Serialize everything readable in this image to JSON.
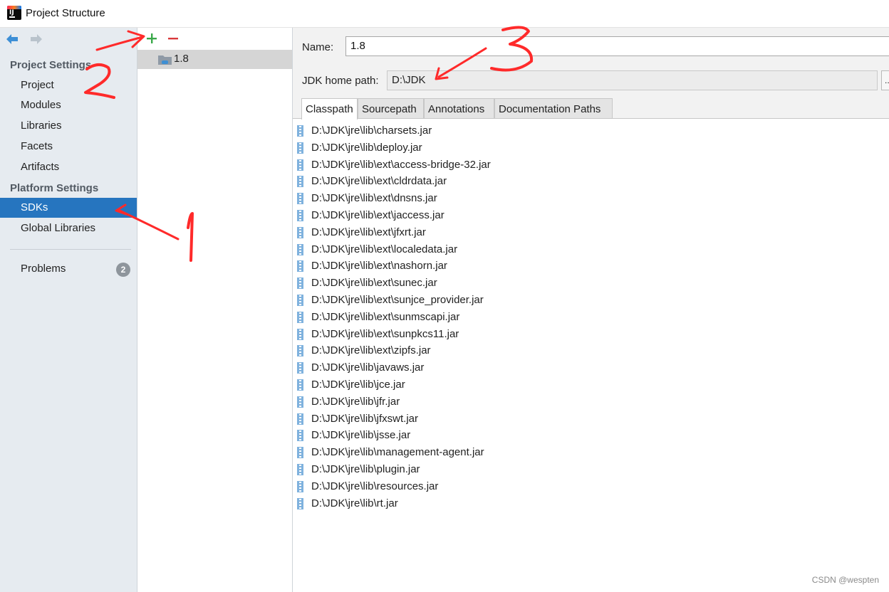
{
  "window": {
    "title": "Project Structure",
    "app_icon_text": "IJ"
  },
  "left_nav": {
    "project_settings_header": "Project Settings",
    "project_items": [
      "Project",
      "Modules",
      "Libraries",
      "Facets",
      "Artifacts"
    ],
    "platform_settings_header": "Platform Settings",
    "platform_items": [
      "SDKs",
      "Global Libraries"
    ],
    "selected": "SDKs",
    "problems": {
      "label": "Problems",
      "count": "2"
    }
  },
  "sdk_list": {
    "items": [
      "1.8"
    ],
    "selected": "1.8"
  },
  "sdk_details": {
    "name_label": "Name:",
    "name_value": "1.8",
    "home_path_label": "JDK home path:",
    "home_path_value": "D:\\JDK",
    "browse_label": "...",
    "tabs": [
      "Classpath",
      "Sourcepath",
      "Annotations",
      "Documentation Paths"
    ],
    "active_tab": "Classpath",
    "classpath": [
      "D:\\JDK\\jre\\lib\\charsets.jar",
      "D:\\JDK\\jre\\lib\\deploy.jar",
      "D:\\JDK\\jre\\lib\\ext\\access-bridge-32.jar",
      "D:\\JDK\\jre\\lib\\ext\\cldrdata.jar",
      "D:\\JDK\\jre\\lib\\ext\\dnsns.jar",
      "D:\\JDK\\jre\\lib\\ext\\jaccess.jar",
      "D:\\JDK\\jre\\lib\\ext\\jfxrt.jar",
      "D:\\JDK\\jre\\lib\\ext\\localedata.jar",
      "D:\\JDK\\jre\\lib\\ext\\nashorn.jar",
      "D:\\JDK\\jre\\lib\\ext\\sunec.jar",
      "D:\\JDK\\jre\\lib\\ext\\sunjce_provider.jar",
      "D:\\JDK\\jre\\lib\\ext\\sunmscapi.jar",
      "D:\\JDK\\jre\\lib\\ext\\sunpkcs11.jar",
      "D:\\JDK\\jre\\lib\\ext\\zipfs.jar",
      "D:\\JDK\\jre\\lib\\javaws.jar",
      "D:\\JDK\\jre\\lib\\jce.jar",
      "D:\\JDK\\jre\\lib\\jfr.jar",
      "D:\\JDK\\jre\\lib\\jfxswt.jar",
      "D:\\JDK\\jre\\lib\\jsse.jar",
      "D:\\JDK\\jre\\lib\\management-agent.jar",
      "D:\\JDK\\jre\\lib\\plugin.jar",
      "D:\\JDK\\jre\\lib\\resources.jar",
      "D:\\JDK\\jre\\lib\\rt.jar"
    ]
  },
  "annotations": {
    "color": "#ff2a2a",
    "labels": [
      "1",
      "2",
      "3"
    ]
  },
  "watermark": "CSDN @wespten",
  "colors": {
    "selection": "#2675bf",
    "sidebar_bg": "#e6ebf0",
    "section_header": "#525a63",
    "add_green": "#3aa84a",
    "remove_red": "#d9393b",
    "nav_arrow": "#3d8fd6"
  }
}
